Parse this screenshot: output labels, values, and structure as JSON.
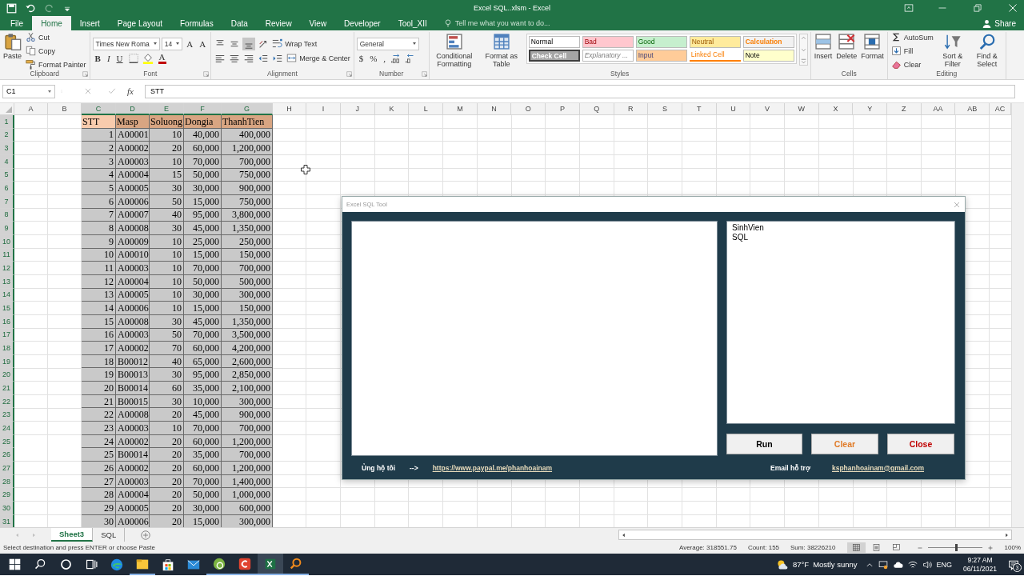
{
  "window": {
    "title": "Excel SQL..xlsm - Excel"
  },
  "ribbon_tabs": [
    {
      "label": "File",
      "selected": false
    },
    {
      "label": "Home",
      "selected": true
    },
    {
      "label": "Insert",
      "selected": false
    },
    {
      "label": "Page Layout",
      "selected": false
    },
    {
      "label": "Formulas",
      "selected": false
    },
    {
      "label": "Data",
      "selected": false
    },
    {
      "label": "Review",
      "selected": false
    },
    {
      "label": "View",
      "selected": false
    },
    {
      "label": "Developer",
      "selected": false
    },
    {
      "label": "Tool_XII",
      "selected": false
    }
  ],
  "tell_me": {
    "placeholder": "Tell me what you want to do..."
  },
  "share": {
    "label": "Share"
  },
  "ribbon_groups": [
    {
      "label": "Clipboard",
      "launcher": true,
      "columns": [
        {
          "kind": "large",
          "label": "Paste"
        },
        {
          "kind": "stack",
          "lines": [
            {
              "items": [
                {
                  "kind": "small",
                  "label": "Cut"
                }
              ]
            },
            {
              "items": [
                {
                  "kind": "small",
                  "label": "Copy"
                }
              ]
            },
            {
              "items": [
                {
                  "kind": "small",
                  "label": "Format Painter"
                }
              ]
            }
          ]
        }
      ]
    },
    {
      "label": "Font",
      "launcher": true,
      "columns": [
        {
          "kind": "stack",
          "lines": [
            {
              "items": [
                {
                  "kind": "combo",
                  "value": "Times New Roma"
                },
                {
                  "kind": "combo",
                  "value": "14"
                },
                {
                  "kind": "glyph",
                  "label": "A"
                },
                {
                  "kind": "glyph",
                  "label": "A"
                }
              ]
            },
            {
              "items": [
                {
                  "kind": "bold",
                  "label": "B"
                },
                {
                  "kind": "italic",
                  "label": "I"
                },
                {
                  "kind": "underline",
                  "label": "U"
                },
                {
                  "kind": "icon"
                },
                {
                  "kind": "icon"
                },
                {
                  "kind": "glyph",
                  "label": "A",
                  "color": "#c00000"
                }
              ]
            }
          ]
        }
      ]
    },
    {
      "label": "Alignment",
      "launcher": true,
      "columns": [
        {
          "kind": "stack",
          "lines": [
            {
              "items": [
                {
                  "kind": "icon",
                  "selected": false
                },
                {
                  "kind": "icon",
                  "selected": false
                },
                {
                  "kind": "icon",
                  "selected": true
                },
                {
                  "kind": "icon",
                  "selected": false
                },
                {
                  "kind": "small",
                  "label": "Wrap Text",
                  "selected": false
                }
              ]
            },
            {
              "items": [
                {
                  "kind": "icon",
                  "selected": false
                },
                {
                  "kind": "icon",
                  "selected": false
                },
                {
                  "kind": "icon",
                  "selected": false
                },
                {
                  "kind": "icon",
                  "selected": false
                },
                {
                  "kind": "icon",
                  "selected": false
                },
                {
                  "kind": "small",
                  "label": "Merge & Center",
                  "selected": false
                }
              ]
            }
          ]
        }
      ]
    },
    {
      "label": "Number",
      "launcher": true,
      "columns": [
        {
          "kind": "stack",
          "lines": [
            {
              "items": [
                {
                  "kind": "combo",
                  "value": "General"
                }
              ]
            },
            {
              "items": [
                {
                  "kind": "glyph",
                  "label": "$"
                },
                {
                  "kind": "glyph",
                  "label": "%"
                },
                {
                  "kind": "glyph",
                  "label": ","
                },
                {
                  "kind": "icon"
                },
                {
                  "kind": "icon"
                }
              ]
            }
          ]
        }
      ]
    },
    {
      "label": "Styles",
      "launcher": false,
      "columns": [
        {
          "kind": "large",
          "label": "Conditional Formatting"
        },
        {
          "kind": "large",
          "label": "Format as Table"
        },
        {
          "kind": "gallery",
          "styles": [
            {
              "label": "Normal",
              "kind": "normal",
              "color": "#ffffff"
            },
            {
              "label": "Bad",
              "kind": "bad",
              "color": "#ffc7ce"
            },
            {
              "label": "Good",
              "kind": "good",
              "color": "#c6efce"
            },
            {
              "label": "Neutral",
              "kind": "neutral",
              "color": "#ffeb9c"
            },
            {
              "label": "Calculation",
              "kind": "calculation",
              "color": "#f2f2f2"
            },
            {
              "label": "Check Cell",
              "kind": "check",
              "color": "#a5a5a5"
            },
            {
              "label": "Explanatory ...",
              "kind": "explanatory",
              "color": "#ffffff"
            },
            {
              "label": "Input",
              "kind": "input",
              "color": "#ffcc99"
            },
            {
              "label": "Linked Cell",
              "kind": "linked",
              "color": "#ffffff"
            },
            {
              "label": "Note",
              "kind": "note",
              "color": "#ffffcc"
            }
          ]
        }
      ]
    },
    {
      "label": "Cells",
      "launcher": false,
      "columns": [
        {
          "kind": "large",
          "label": "Insert"
        },
        {
          "kind": "large",
          "label": "Delete"
        },
        {
          "kind": "large",
          "label": "Format"
        }
      ]
    },
    {
      "label": "Editing",
      "launcher": false,
      "columns": [
        {
          "kind": "stack",
          "lines": [
            {
              "items": [
                {
                  "kind": "small",
                  "label": "AutoSum"
                }
              ]
            },
            {
              "items": [
                {
                  "kind": "small",
                  "label": "Fill"
                }
              ]
            },
            {
              "items": [
                {
                  "kind": "small",
                  "label": "Clear"
                }
              ]
            }
          ]
        },
        {
          "kind": "large",
          "label": "Sort & Filter"
        },
        {
          "kind": "large",
          "label": "Find & Select"
        }
      ]
    }
  ],
  "formula_bar": {
    "name_box": "C1",
    "function_label": "fx",
    "value": "STT"
  },
  "sheet": {
    "columns": [
      {
        "label": "A",
        "selected": false
      },
      {
        "label": "B",
        "selected": false
      },
      {
        "label": "C",
        "selected": true
      },
      {
        "label": "D",
        "selected": true
      },
      {
        "label": "E",
        "selected": true
      },
      {
        "label": "F",
        "selected": true
      },
      {
        "label": "G",
        "selected": true
      },
      {
        "label": "H",
        "selected": false
      },
      {
        "label": "I",
        "selected": false
      },
      {
        "label": "J",
        "selected": false
      },
      {
        "label": "K",
        "selected": false
      },
      {
        "label": "L",
        "selected": false
      },
      {
        "label": "M",
        "selected": false
      },
      {
        "label": "N",
        "selected": false
      },
      {
        "label": "O",
        "selected": false
      },
      {
        "label": "P",
        "selected": false
      },
      {
        "label": "Q",
        "selected": false
      },
      {
        "label": "R",
        "selected": false
      },
      {
        "label": "S",
        "selected": false
      },
      {
        "label": "T",
        "selected": false
      },
      {
        "label": "U",
        "selected": false
      },
      {
        "label": "V",
        "selected": false
      },
      {
        "label": "W",
        "selected": false
      },
      {
        "label": "X",
        "selected": false
      },
      {
        "label": "Y",
        "selected": false
      },
      {
        "label": "Z",
        "selected": false
      },
      {
        "label": "AA",
        "selected": false
      },
      {
        "label": "AB",
        "selected": false
      },
      {
        "label": "AC",
        "selected": false
      }
    ],
    "rows": [
      {
        "number": "1",
        "selected": true,
        "cells": [
          "",
          "",
          {
            "text": "STT",
            "active": true
          },
          {
            "text": "Masp",
            "active": false
          },
          {
            "text": "Soluong",
            "active": false
          },
          {
            "text": "Dongia",
            "active": false
          },
          {
            "text": "ThanhTien",
            "active": false
          }
        ]
      },
      {
        "number": "2",
        "selected": true,
        "cells": [
          "",
          "",
          "1",
          "A00001",
          "10",
          "40,000",
          "400,000"
        ]
      },
      {
        "number": "3",
        "selected": true,
        "cells": [
          "",
          "",
          "2",
          "A00002",
          "20",
          "60,000",
          "1,200,000"
        ]
      },
      {
        "number": "4",
        "selected": true,
        "cells": [
          "",
          "",
          "3",
          "A00003",
          "10",
          "70,000",
          "700,000"
        ]
      },
      {
        "number": "5",
        "selected": true,
        "cells": [
          "",
          "",
          "4",
          "A00004",
          "15",
          "50,000",
          "750,000"
        ]
      },
      {
        "number": "6",
        "selected": true,
        "cells": [
          "",
          "",
          "5",
          "A00005",
          "30",
          "30,000",
          "900,000"
        ]
      },
      {
        "number": "7",
        "selected": true,
        "cells": [
          "",
          "",
          "6",
          "A00006",
          "50",
          "15,000",
          "750,000"
        ]
      },
      {
        "number": "8",
        "selected": true,
        "cells": [
          "",
          "",
          "7",
          "A00007",
          "40",
          "95,000",
          "3,800,000"
        ]
      },
      {
        "number": "9",
        "selected": true,
        "cells": [
          "",
          "",
          "8",
          "A00008",
          "30",
          "45,000",
          "1,350,000"
        ]
      },
      {
        "number": "10",
        "selected": true,
        "cells": [
          "",
          "",
          "9",
          "A00009",
          "10",
          "25,000",
          "250,000"
        ]
      },
      {
        "number": "11",
        "selected": true,
        "cells": [
          "",
          "",
          "10",
          "A00010",
          "10",
          "15,000",
          "150,000"
        ]
      },
      {
        "number": "12",
        "selected": true,
        "cells": [
          "",
          "",
          "11",
          "A00003",
          "10",
          "70,000",
          "700,000"
        ]
      },
      {
        "number": "13",
        "selected": true,
        "cells": [
          "",
          "",
          "12",
          "A00004",
          "10",
          "50,000",
          "500,000"
        ]
      },
      {
        "number": "14",
        "selected": true,
        "cells": [
          "",
          "",
          "13",
          "A00005",
          "10",
          "30,000",
          "300,000"
        ]
      },
      {
        "number": "15",
        "selected": true,
        "cells": [
          "",
          "",
          "14",
          "A00006",
          "10",
          "15,000",
          "150,000"
        ]
      },
      {
        "number": "16",
        "selected": true,
        "cells": [
          "",
          "",
          "15",
          "A00008",
          "30",
          "45,000",
          "1,350,000"
        ]
      },
      {
        "number": "17",
        "selected": true,
        "cells": [
          "",
          "",
          "16",
          "A00003",
          "50",
          "70,000",
          "3,500,000"
        ]
      },
      {
        "number": "18",
        "selected": true,
        "cells": [
          "",
          "",
          "17",
          "A00002",
          "70",
          "60,000",
          "4,200,000"
        ]
      },
      {
        "number": "19",
        "selected": true,
        "cells": [
          "",
          "",
          "18",
          "B00012",
          "40",
          "65,000",
          "2,600,000"
        ]
      },
      {
        "number": "20",
        "selected": true,
        "cells": [
          "",
          "",
          "19",
          "B00013",
          "30",
          "95,000",
          "2,850,000"
        ]
      },
      {
        "number": "21",
        "selected": true,
        "cells": [
          "",
          "",
          "20",
          "B00014",
          "60",
          "35,000",
          "2,100,000"
        ]
      },
      {
        "number": "22",
        "selected": true,
        "cells": [
          "",
          "",
          "21",
          "B00015",
          "30",
          "10,000",
          "300,000"
        ]
      },
      {
        "number": "23",
        "selected": true,
        "cells": [
          "",
          "",
          "22",
          "A00008",
          "20",
          "45,000",
          "900,000"
        ]
      },
      {
        "number": "24",
        "selected": true,
        "cells": [
          "",
          "",
          "23",
          "A00003",
          "10",
          "70,000",
          "700,000"
        ]
      },
      {
        "number": "25",
        "selected": true,
        "cells": [
          "",
          "",
          "24",
          "A00002",
          "20",
          "60,000",
          "1,200,000"
        ]
      },
      {
        "number": "26",
        "selected": true,
        "cells": [
          "",
          "",
          "25",
          "B00014",
          "20",
          "35,000",
          "700,000"
        ]
      },
      {
        "number": "27",
        "selected": true,
        "cells": [
          "",
          "",
          "26",
          "A00002",
          "20",
          "60,000",
          "1,200,000"
        ]
      },
      {
        "number": "28",
        "selected": true,
        "cells": [
          "",
          "",
          "27",
          "A00003",
          "20",
          "70,000",
          "1,400,000"
        ]
      },
      {
        "number": "29",
        "selected": true,
        "cells": [
          "",
          "",
          "28",
          "A00004",
          "20",
          "50,000",
          "1,000,000"
        ]
      },
      {
        "number": "30",
        "selected": true,
        "cells": [
          "",
          "",
          "29",
          "A00005",
          "20",
          "30,000",
          "600,000"
        ]
      },
      {
        "number": "31",
        "selected": true,
        "cells": [
          "",
          "",
          "30",
          "A00006",
          "20",
          "15,000",
          "300,000"
        ]
      }
    ]
  },
  "sheet_tabs": [
    {
      "label": "Sheet3",
      "selected": true
    },
    {
      "label": "SQL",
      "selected": false
    }
  ],
  "status_bar": {
    "message": "Select destination and press ENTER or choose Paste",
    "average": "Average: 318551.75",
    "count": "Count: 155",
    "sum": "Sum: 38226210",
    "views": [
      {
        "selected": true
      },
      {
        "selected": false
      },
      {
        "selected": false
      }
    ],
    "zoom": {
      "level": 0.5,
      "reading": "100%"
    }
  },
  "dialog": {
    "title": "Excel SQL Tool",
    "tables": [
      {
        "label": "SinhVien"
      },
      {
        "label": "SQL"
      }
    ],
    "buttons": [
      {
        "label": "Run",
        "color": "#000000"
      },
      {
        "label": "Clear",
        "color": "#e07b28"
      },
      {
        "label": "Close",
        "color": "#c00000"
      }
    ],
    "support_label": "Ủng hộ tôi",
    "support_arrow": "-->",
    "support_link": "https://www.paypal.me/phanhoainam",
    "email_label": "Email hỗ trợ",
    "email_link": "ksphanhoainam@gmail.com"
  },
  "taskbar": {
    "apps": [
      {
        "running": false,
        "selected": false
      },
      {
        "running": true,
        "selected": false
      },
      {
        "running": false,
        "selected": false
      },
      {
        "running": false,
        "selected": false
      },
      {
        "running": true,
        "selected": false
      },
      {
        "running": true,
        "selected": false
      },
      {
        "running": true,
        "selected": true
      },
      {
        "running": true,
        "selected": false
      }
    ],
    "weather": {
      "temperature": "87°F",
      "condition": "Mostly sunny"
    },
    "language": "ENG",
    "time": "9:27 AM",
    "date": "06/11/2021",
    "notifications": "3"
  }
}
